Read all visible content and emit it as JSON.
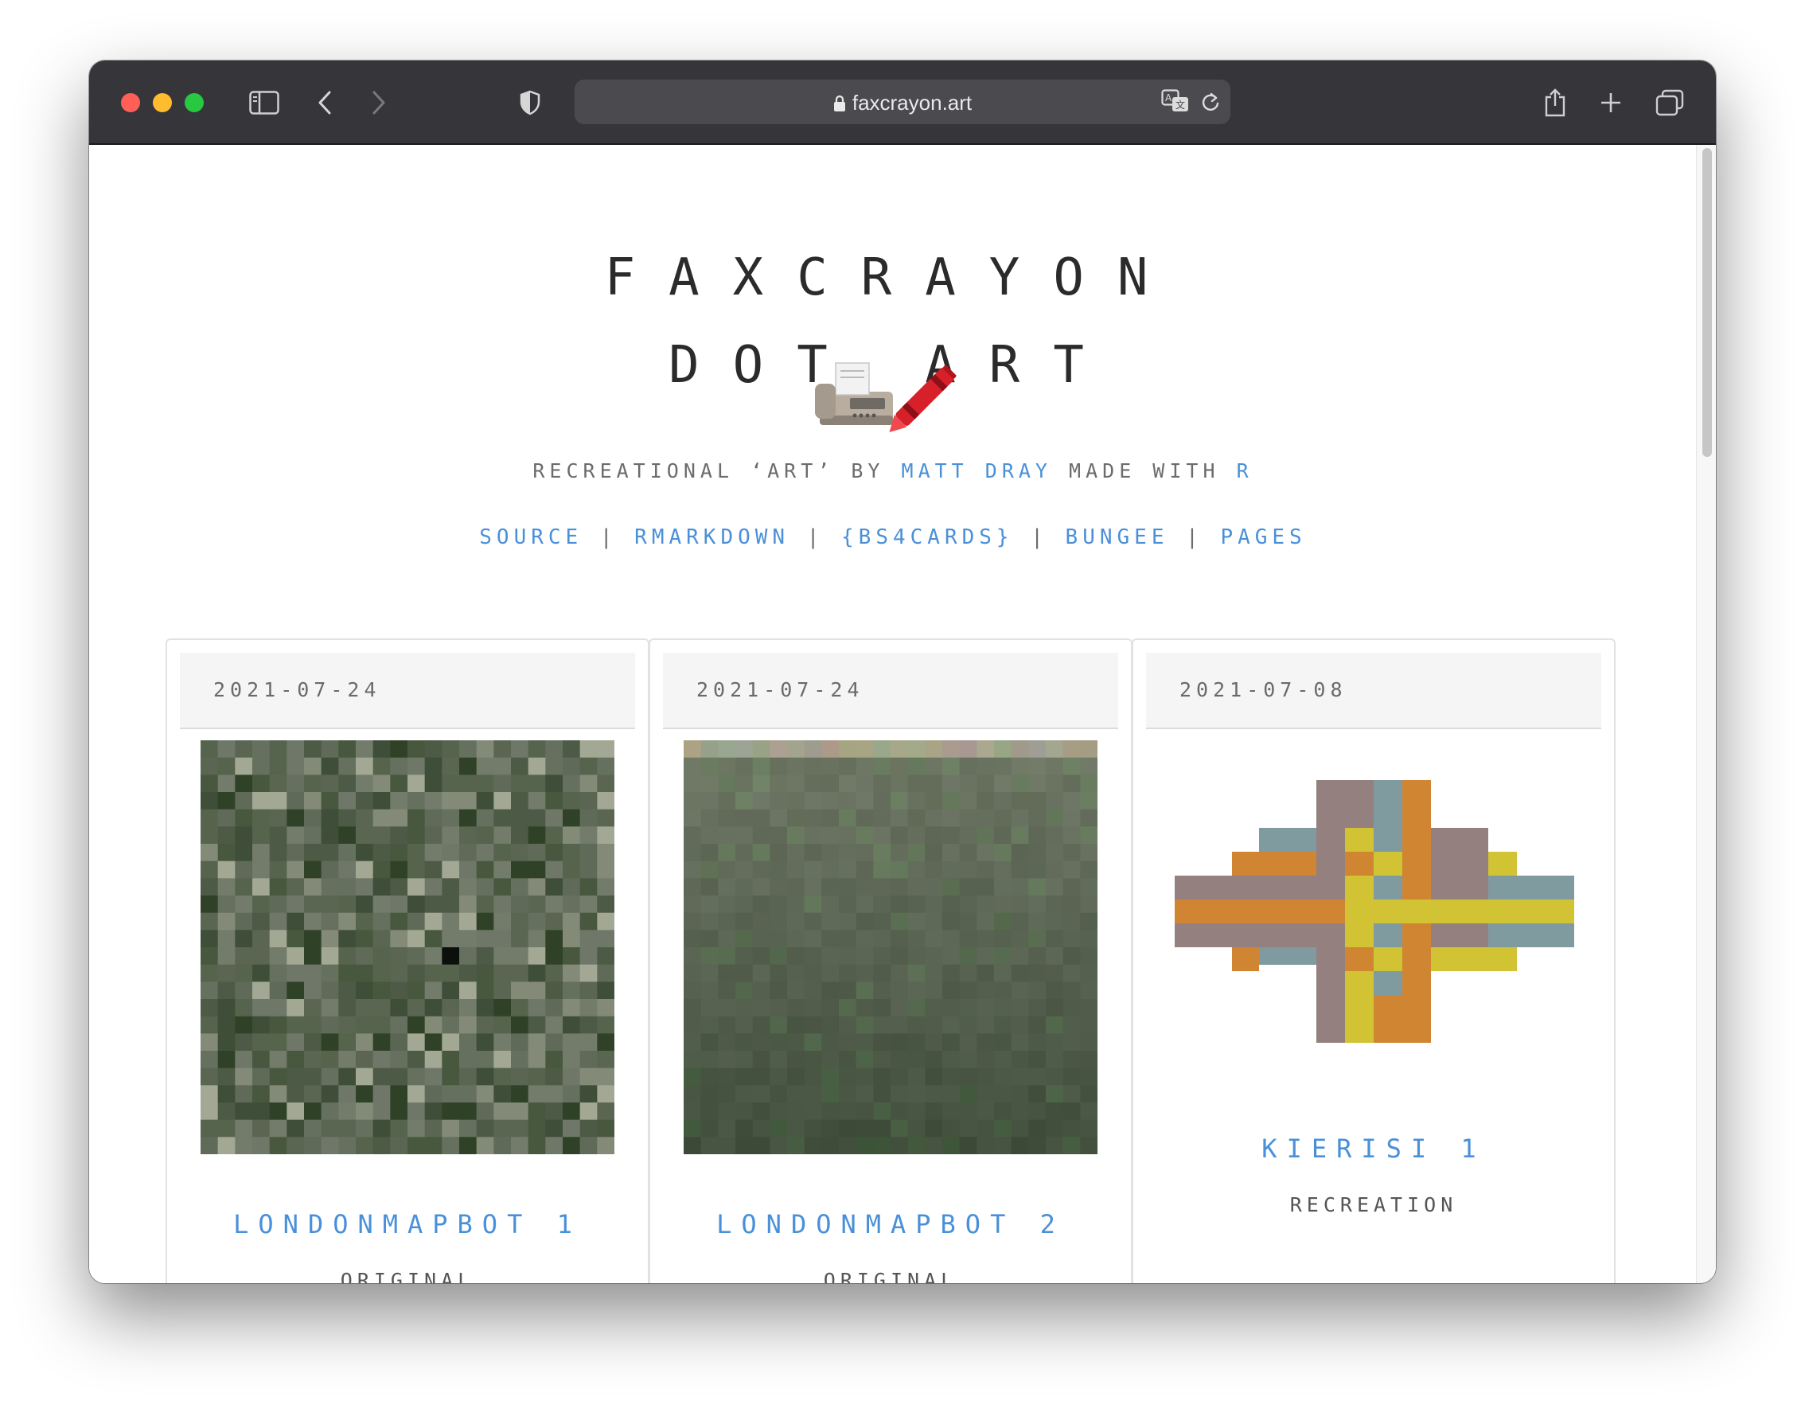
{
  "browser": {
    "url": "faxcrayon.art",
    "colors": {
      "close": "#ff5f57",
      "minimize": "#febc2e",
      "zoom": "#28c840"
    },
    "icons": [
      "sidebar-icon",
      "back-icon",
      "forward-icon",
      "shield-icon",
      "lock-icon",
      "translate-icon",
      "reload-icon",
      "share-icon",
      "new-tab-icon",
      "tabs-overview-icon"
    ]
  },
  "page": {
    "title_line1": "FAXCRAYON",
    "title_line2": "DOT ART",
    "emoji": "📠🖍️",
    "tagline": {
      "prefix": "RECREATIONAL ‘ART’ BY ",
      "author": "MATT DRAY",
      "middle": " MADE WITH ",
      "tool": "R"
    },
    "links": [
      "SOURCE",
      "RMARKDOWN",
      "{BS4CARDS}",
      "BUNGEE",
      "PAGES"
    ],
    "link_separator": "|",
    "accent_color": "#4a90d9"
  },
  "cards": [
    {
      "date": "2021-07-24",
      "title": "LONDONMAPBOT 1",
      "subtitle": "ORIGINAL"
    },
    {
      "date": "2021-07-24",
      "title": "LONDONMAPBOT 2",
      "subtitle": "ORIGINAL"
    },
    {
      "date": "2021-07-08",
      "title": "KIERISI 1",
      "subtitle": "RECREATION"
    }
  ]
}
